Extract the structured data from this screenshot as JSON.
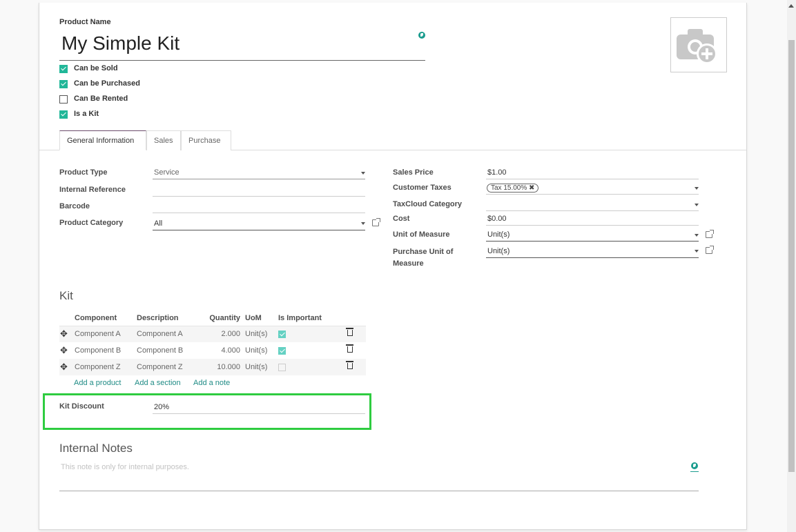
{
  "product": {
    "name_label": "Product Name",
    "name": "My Simple Kit"
  },
  "options": [
    {
      "label": "Can be Sold",
      "checked": true
    },
    {
      "label": "Can be Purchased",
      "checked": true
    },
    {
      "label": "Can Be Rented",
      "checked": false
    },
    {
      "label": "Is a Kit",
      "checked": true
    }
  ],
  "tabs": [
    {
      "label": "General Information",
      "active": true
    },
    {
      "label": "Sales",
      "active": false
    },
    {
      "label": "Purchase",
      "active": false
    }
  ],
  "left_fields": {
    "product_type": {
      "label": "Product Type",
      "value": "Service"
    },
    "internal_reference": {
      "label": "Internal Reference",
      "value": ""
    },
    "barcode": {
      "label": "Barcode",
      "value": ""
    },
    "product_category": {
      "label": "Product Category",
      "value": "All"
    }
  },
  "right_fields": {
    "sales_price": {
      "label": "Sales Price",
      "currency": "$",
      "value": "1.00"
    },
    "customer_taxes": {
      "label": "Customer Taxes",
      "tag": "Tax 15.00%"
    },
    "taxcloud_category": {
      "label": "TaxCloud Category",
      "value": ""
    },
    "cost": {
      "label": "Cost",
      "currency": "$",
      "value": "0.00"
    },
    "uom": {
      "label": "Unit of Measure",
      "value": "Unit(s)"
    },
    "purchase_uom": {
      "label_line1": "Purchase Unit of",
      "label_line2": "Measure",
      "value": "Unit(s)"
    }
  },
  "kit": {
    "title": "Kit",
    "columns": [
      "Component",
      "Description",
      "Quantity",
      "UoM",
      "Is Important"
    ],
    "rows": [
      {
        "component": "Component A",
        "description": "Component A",
        "quantity": "2.000",
        "uom": "Unit(s)",
        "important": true
      },
      {
        "component": "Component B",
        "description": "Component B",
        "quantity": "4.000",
        "uom": "Unit(s)",
        "important": true
      },
      {
        "component": "Component Z",
        "description": "Component Z",
        "quantity": "10.000",
        "uom": "Unit(s)",
        "important": false
      }
    ],
    "add_product": "Add a product",
    "add_section": "Add a section",
    "add_note": "Add a note"
  },
  "kit_discount": {
    "label": "Kit Discount",
    "value": "20%"
  },
  "internal_notes": {
    "title": "Internal Notes",
    "placeholder": "This note is only for internal purposes."
  },
  "colors": {
    "accent": "#21b799",
    "link": "#1f8b85",
    "highlight": "#2ecc40"
  }
}
